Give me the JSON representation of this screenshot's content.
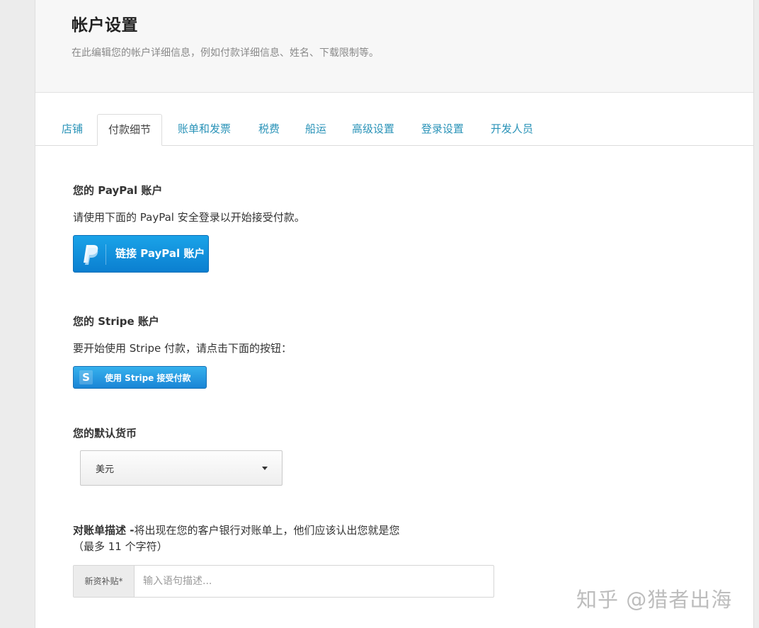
{
  "header": {
    "title": "帐户设置",
    "subtitle": "在此编辑您的帐户详细信息，例如付款详细信息、姓名、下载限制等。"
  },
  "tabs": [
    {
      "label": "店铺",
      "active": false
    },
    {
      "label": "付款细节",
      "active": true
    },
    {
      "label": "账单和发票",
      "active": false
    },
    {
      "label": "税费",
      "active": false
    },
    {
      "label": "船运",
      "active": false
    },
    {
      "label": "高级设置",
      "active": false
    },
    {
      "label": "登录设置",
      "active": false
    },
    {
      "label": "开发人员",
      "active": false
    }
  ],
  "paypal": {
    "heading": "您的 PayPal 账户",
    "description": "请使用下面的 PayPal 安全登录以开始接受付款。",
    "button_label": "链接 PayPal 账户",
    "icon": "paypal-logo-icon"
  },
  "stripe": {
    "heading": "您的 Stripe 账户",
    "description": "要开始使用 Stripe 付款，请点击下面的按钮：",
    "button_label": "使用 Stripe 接受付款",
    "icon_glyph": "S"
  },
  "currency": {
    "heading": "您的默认货币",
    "selected": "美元"
  },
  "statement": {
    "label_bold": "对账单描述 -",
    "label_rest": "将出现在您的客户银行对账单上，他们应该认出您就是您",
    "limit_note": "（最多 11 个字符）",
    "prefix": "新资补贴*",
    "placeholder": "输入语句描述..."
  },
  "watermark": "知乎 @猎者出海",
  "colors": {
    "tab_link": "#2a93b8",
    "paypal_blue": "#0b7fd0",
    "stripe_blue": "#1a85d6"
  }
}
